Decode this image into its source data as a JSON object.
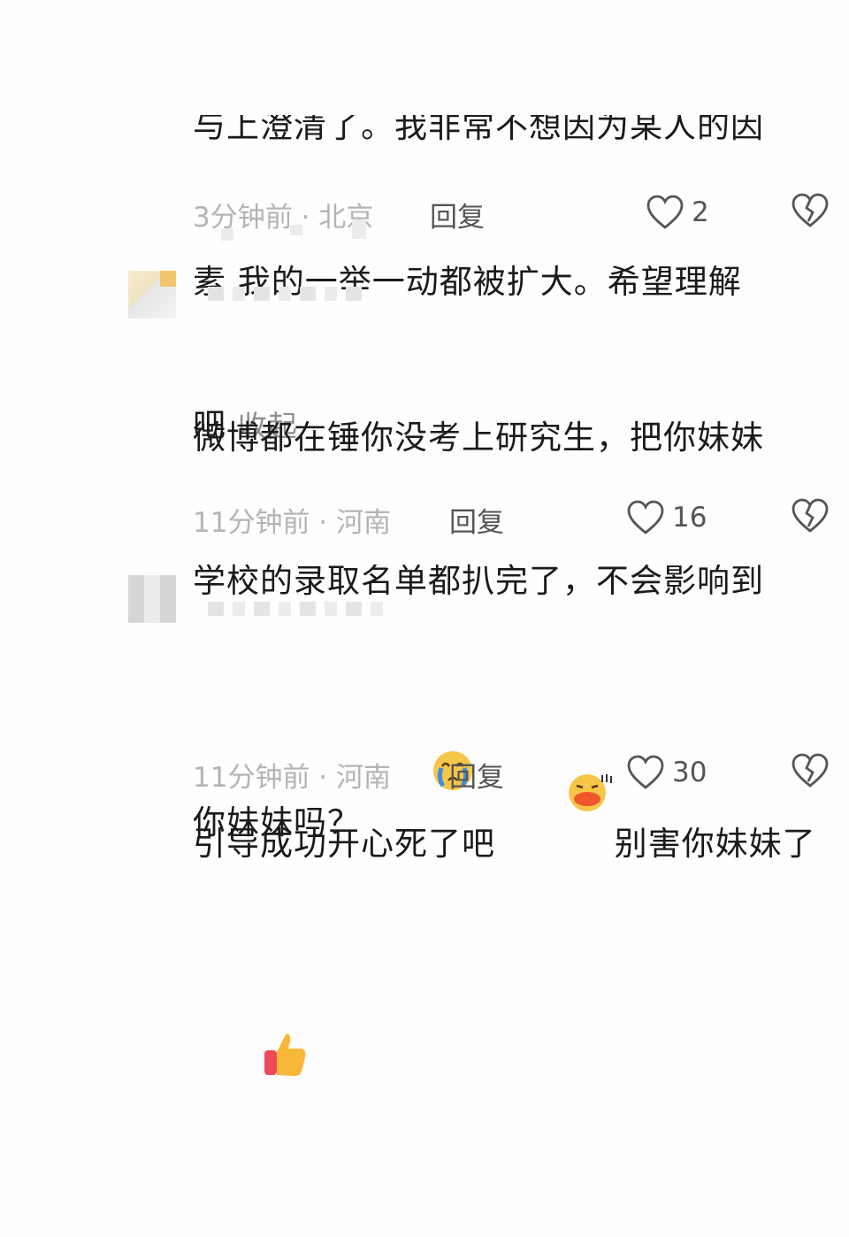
{
  "comments": [
    {
      "text_lines": [
        "与上澄清了。我非常不想因为某人的因",
        "素 我的一举一动都被扩大。希望理解",
        "吧"
      ],
      "collapse_label": "收起",
      "time_location": "3分钟前 · 北京",
      "reply_label": "回复",
      "like_count": "2"
    },
    {
      "text_lines": [
        "微博都在锤你没考上研究生，把你妹妹",
        "学校的录取名单都扒完了，不会影响到",
        "你妹妹吗？"
      ],
      "emoji": "crying-face",
      "time_location": "11分钟前 · 河南",
      "reply_label": "回复",
      "like_count": "16"
    },
    {
      "text_lines": [
        "引导成功开心死了吧",
        "别害你妹妹了"
      ],
      "emoji": "lips-face",
      "emoji2": "thumbs-up",
      "time_location": "11分钟前 · 河南",
      "reply_label": "回复",
      "like_count": "30"
    }
  ],
  "colors": {
    "meta": "#b4b4b4",
    "action": "#555555",
    "text": "#1a1a1a"
  }
}
